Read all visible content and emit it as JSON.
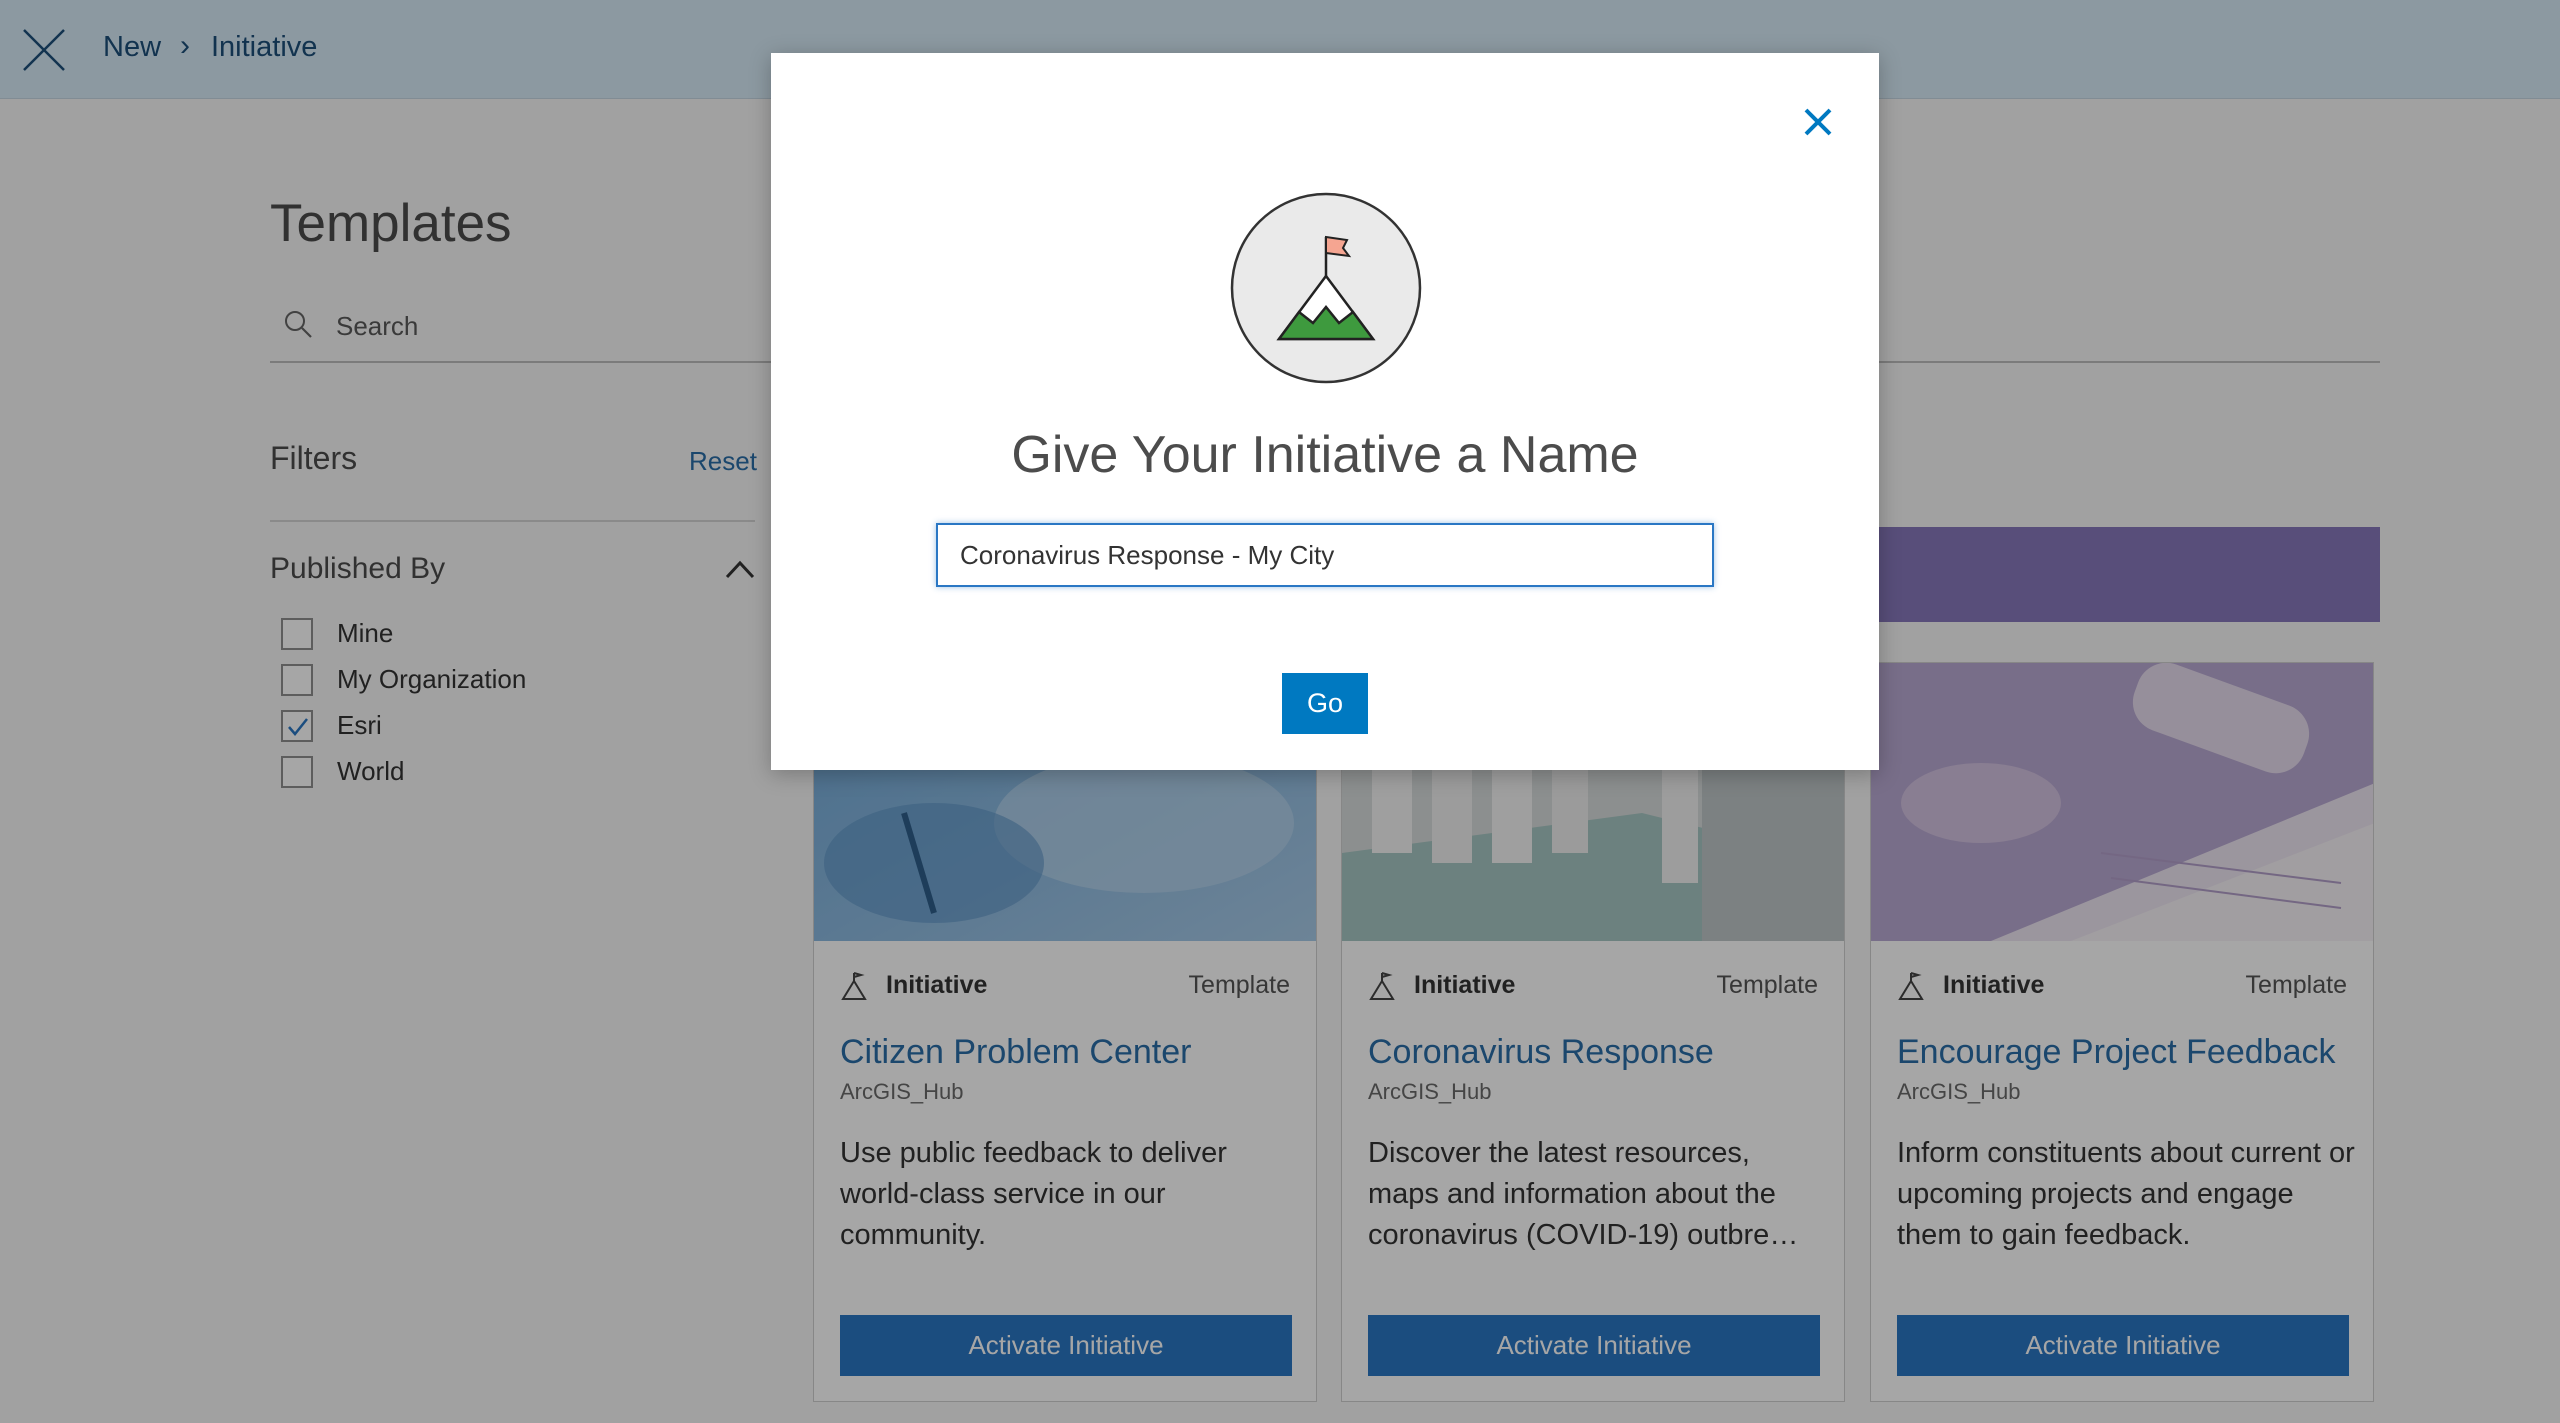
{
  "header": {
    "close_icon": "close-icon",
    "breadcrumb": {
      "new": "New",
      "separator": "›",
      "current": "Initiative"
    }
  },
  "main": {
    "title": "Templates",
    "search": {
      "placeholder": "Search",
      "icon": "search-icon"
    },
    "filters": {
      "title": "Filters",
      "reset": "Reset",
      "published_by": {
        "title": "Published By",
        "options": [
          {
            "label": "Mine",
            "checked": false
          },
          {
            "label": "My Organization",
            "checked": false
          },
          {
            "label": "Esri",
            "checked": true
          },
          {
            "label": "World",
            "checked": false
          }
        ]
      }
    },
    "cards": [
      {
        "type": "Initiative",
        "kind": "Template",
        "title": "Citizen Problem Center",
        "owner": "ArcGIS_Hub",
        "description": "Use public feedback to deliver world-class service in our community.",
        "button": "Activate Initiative"
      },
      {
        "type": "Initiative",
        "kind": "Template",
        "title": "Coronavirus Response",
        "owner": "ArcGIS_Hub",
        "description": "Discover the latest resources, maps and information about the coronavirus (COVID-19) outbre…",
        "button": "Activate Initiative"
      },
      {
        "type": "Initiative",
        "kind": "Template",
        "title": "Encourage Project Feedback",
        "owner": "ArcGIS_Hub",
        "description": "Inform constituents about current or upcoming projects and engage them to gain feedback.",
        "button": "Activate Initiative"
      }
    ]
  },
  "modal": {
    "icon": "mountain-flag-icon",
    "title": "Give Your Initiative a Name",
    "input_value": "Coronavirus Response - My City",
    "go": "Go"
  },
  "colors": {
    "header_bg": "#d7ebf8",
    "accent": "#0079c1",
    "link": "#2a6ea8",
    "banner": "#8878bc"
  }
}
